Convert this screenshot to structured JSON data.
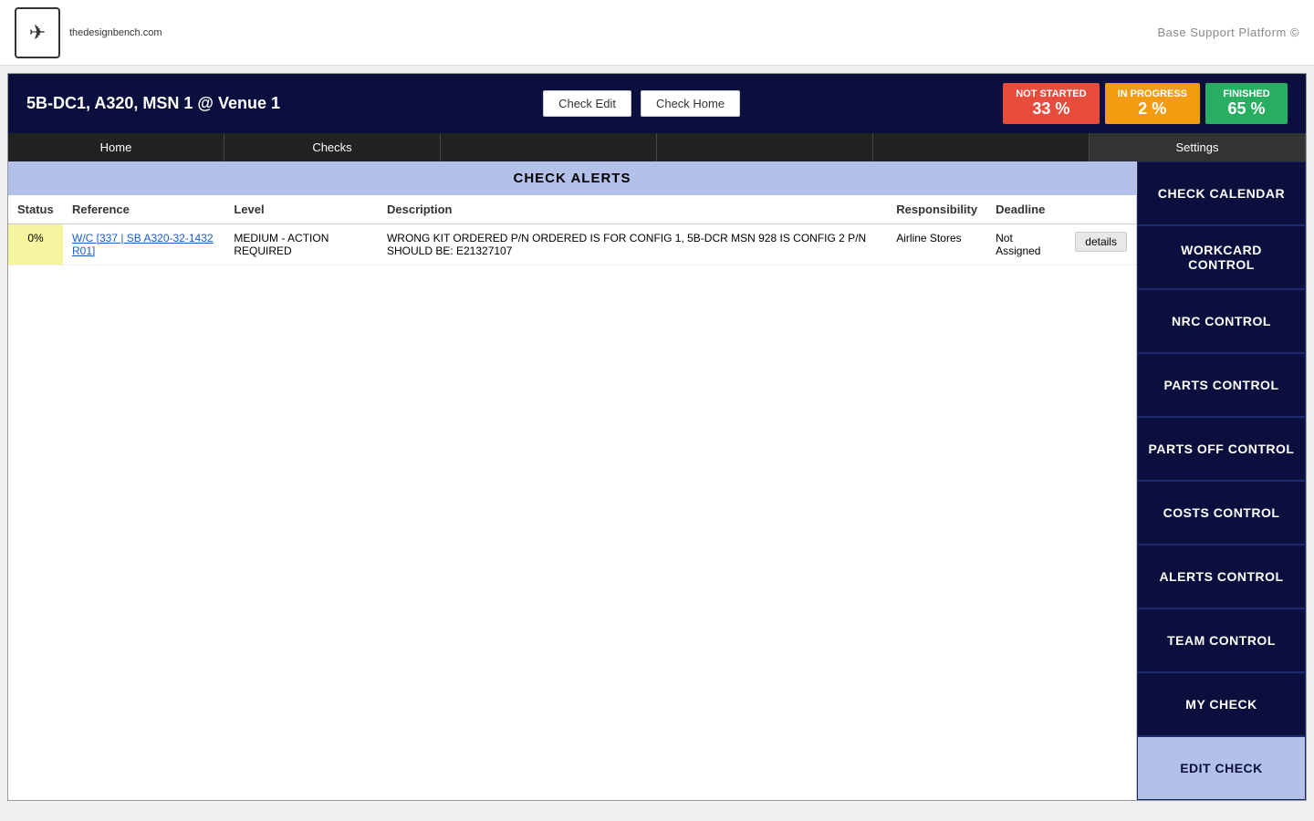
{
  "topbar": {
    "brand": "thedesignbench.com",
    "copyright": "Base Support Platform ©"
  },
  "header": {
    "title": "5B-DC1, A320, MSN 1 @ Venue 1",
    "check_edit_label": "Check Edit",
    "check_home_label": "Check Home",
    "not_started_label": "NOT STARTED",
    "not_started_pct": "33 %",
    "in_progress_label": "IN PROGRESS",
    "in_progress_pct": "2 %",
    "finished_label": "FINISHED",
    "finished_pct": "65 %"
  },
  "nav": {
    "items": [
      {
        "label": "Home"
      },
      {
        "label": "Checks"
      },
      {
        "label": ""
      },
      {
        "label": ""
      },
      {
        "label": ""
      },
      {
        "label": "Settings"
      }
    ]
  },
  "section": {
    "title": "CHECK ALERTS"
  },
  "table": {
    "columns": [
      "Status",
      "Reference",
      "Level",
      "Description",
      "Responsibility",
      "Deadline",
      ""
    ],
    "rows": [
      {
        "status": "0%",
        "reference": "W/C [337 | SB A320-32-1432 R01]",
        "level": "MEDIUM - ACTION REQUIRED",
        "description": "WRONG KIT ORDERED P/N ORDERED IS FOR CONFIG 1, 5B-DCR MSN 928 IS CONFIG 2 P/N SHOULD BE: E21327107",
        "responsibility": "Airline Stores",
        "deadline": "Not Assigned",
        "action": "details"
      }
    ]
  },
  "sidebar": {
    "buttons": [
      {
        "label": "CHECK CALENDAR",
        "id": "check-calendar"
      },
      {
        "label": "WORKCARD CONTROL",
        "id": "workcard-control"
      },
      {
        "label": "NRC CONTROL",
        "id": "nrc-control"
      },
      {
        "label": "PARTS CONTROL",
        "id": "parts-control"
      },
      {
        "label": "PARTS OFF CONTROL",
        "id": "parts-off-control"
      },
      {
        "label": "COSTS CONTROL",
        "id": "costs-control"
      },
      {
        "label": "ALERTS CONTROL",
        "id": "alerts-control"
      },
      {
        "label": "TEAM CONTROL",
        "id": "team-control"
      },
      {
        "label": "MY CHECK",
        "id": "my-check"
      },
      {
        "label": "EDIT CHECK",
        "id": "edit-check",
        "style": "light"
      }
    ]
  }
}
